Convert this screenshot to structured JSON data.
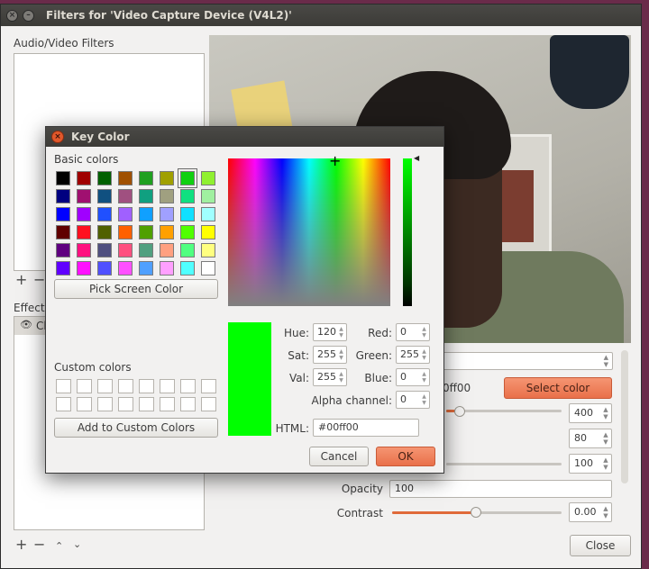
{
  "window": {
    "title": "Filters for 'Video Capture Device (V4L2)'",
    "audio_video_label": "Audio/Video Filters",
    "effect_label": "Effect",
    "effect_item": "Ch",
    "controls": {
      "plus": "+",
      "minus": "−",
      "up": "⌃",
      "down": "⌄"
    },
    "props": {
      "color_value_fragment": "0ff00",
      "select_color_label": "Select color",
      "similarity_value": "400",
      "smoothness_value": "80",
      "spill_value": "100",
      "opacity_label": "Opacity",
      "opacity_value": "100",
      "contrast_label": "Contrast",
      "contrast_value": "0.00"
    },
    "close_label": "Close"
  },
  "dialog": {
    "title": "Key Color",
    "basic_colors_label": "Basic colors",
    "pick_screen_label": "Pick Screen Color",
    "custom_colors_label": "Custom colors",
    "add_custom_label": "Add to Custom Colors",
    "fields": {
      "hue_label": "Hue:",
      "hue_value": "120",
      "sat_label": "Sat:",
      "sat_value": "255",
      "val_label": "Val:",
      "val_value": "255",
      "red_label": "Red:",
      "red_value": "0",
      "green_label": "Green:",
      "green_value": "255",
      "blue_label": "Blue:",
      "blue_value": "0",
      "alpha_label": "Alpha channel:",
      "alpha_value": "0",
      "html_label": "HTML:",
      "html_value": "#00ff00"
    },
    "cancel_label": "Cancel",
    "ok_label": "OK",
    "current_color": "#00ff00",
    "basic_colors": [
      [
        "#000000",
        "#a00000",
        "#006000",
        "#a05000",
        "#20a020",
        "#a0a000",
        "#10d010",
        "#90f030"
      ],
      [
        "#000080",
        "#a01070",
        "#105080",
        "#a05080",
        "#10a080",
        "#a0a080",
        "#10e080",
        "#a0f0a0"
      ],
      [
        "#0000ff",
        "#a000ff",
        "#2050ff",
        "#a060ff",
        "#10a0ff",
        "#a0a0ff",
        "#10e0ff",
        "#a0ffff"
      ],
      [
        "#600000",
        "#ff1020",
        "#506000",
        "#ff6000",
        "#50a000",
        "#ffa000",
        "#50ff00",
        "#ffff00"
      ],
      [
        "#600080",
        "#ff1080",
        "#505080",
        "#ff5080",
        "#50a080",
        "#ffa080",
        "#50ff80",
        "#ffff80"
      ],
      [
        "#6000ff",
        "#ff10ff",
        "#5050ff",
        "#ff50ff",
        "#50a0ff",
        "#ffa0ff",
        "#50ffff",
        "#ffffff"
      ]
    ]
  }
}
